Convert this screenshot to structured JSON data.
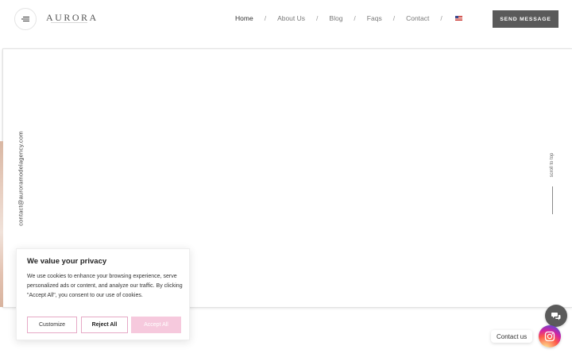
{
  "header": {
    "logo": "AURORA",
    "nav": [
      {
        "label": "Home",
        "active": true
      },
      {
        "label": "About Us",
        "active": false
      },
      {
        "label": "Blog",
        "active": false
      },
      {
        "label": "Faqs",
        "active": false
      },
      {
        "label": "Contact",
        "active": false
      }
    ],
    "separator": "/",
    "language_icon": "us-flag-icon",
    "send_button": "SEND MESSAGE"
  },
  "hero": {
    "email": "contact@auroramodelagency.com",
    "scroll_to_top": "scroll to top"
  },
  "cookie_banner": {
    "title": "We value your privacy",
    "body": "We use cookies to enhance your browsing experience, serve personalized ads or content, and analyze our traffic. By clicking \"Accept All\", you consent to our use of cookies.",
    "customize": "Customize",
    "reject": "Reject All",
    "accept": "Accept All"
  },
  "floating": {
    "contact_label": "Contact us",
    "chat_icon": "chat-bubbles-icon",
    "instagram_icon": "instagram-icon"
  },
  "colors": {
    "send_button_bg": "#5a5a5a",
    "accept_bg": "#f6c9dd",
    "button_border": "#e6a9c6"
  }
}
